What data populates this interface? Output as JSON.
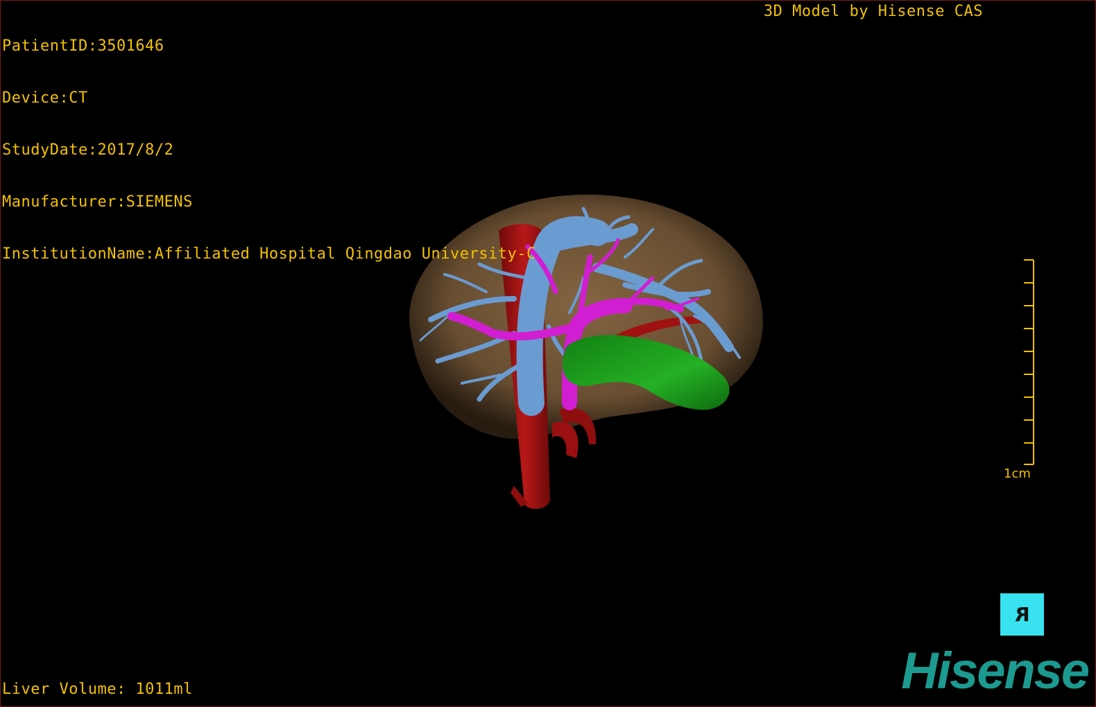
{
  "overlay": {
    "patient_id": "PatientID:3501646",
    "device": "Device:CT",
    "study_date": "StudyDate:2017/8/2",
    "manufacturer": "Manufacturer:SIEMENS",
    "institution": "InstitutionName:Affiliated Hospital Qingdao University-C",
    "credit": "3D Model by Hisense CAS",
    "liver_volume": "Liver Volume: 1011ml"
  },
  "scale": {
    "label": "1cm"
  },
  "orientation": {
    "label": "R"
  },
  "brand": {
    "logo": "Hisense"
  },
  "colors": {
    "text": "#f2c200",
    "liver": "#8a6a45",
    "hepatic_vein": "#6a9bd1",
    "portal_vein": "#d21ed2",
    "artery_ivc": "#a81414",
    "gallbladder": "#1a8c1a",
    "orientation_cube": "#39e2ef",
    "logo": "#1c9a8f"
  }
}
